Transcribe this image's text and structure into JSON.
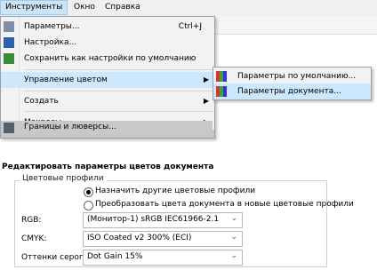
{
  "menubar": {
    "items": [
      {
        "label": "Инструменты",
        "active": true
      },
      {
        "label": "Окно",
        "active": false
      },
      {
        "label": "Справка",
        "active": false
      }
    ]
  },
  "menu": {
    "items": [
      {
        "label": "Параметры...",
        "shortcut": "Ctrl+J",
        "icon": "options-icon"
      },
      {
        "label": "Настройка...",
        "icon": "customize-icon"
      },
      {
        "label": "Сохранить как настройки по умолчанию",
        "icon": "save-defaults-icon"
      },
      {
        "label": "Управление цветом",
        "submenu": true
      },
      {
        "label": "Создать",
        "submenu": true
      },
      {
        "label": "Макросы",
        "submenu": true
      },
      {
        "label": "Границы и люверсы...",
        "icon": "grommets-icon"
      }
    ]
  },
  "submenu": {
    "items": [
      {
        "label": "Параметры по умолчанию...",
        "icon": "palette-icon"
      },
      {
        "label": "Параметры документа...",
        "icon": "palette-icon"
      }
    ]
  },
  "dialog": {
    "title": "Редактировать параметры цветов документа",
    "group_label": "Цветовые профили",
    "radio_assign": "Назначить другие цветовые профили",
    "radio_convert": "Преобразовать цвета документа в новые цветовые профили",
    "rgb_label": "RGB:",
    "rgb_value": "(Монитор-1) sRGB IEC61966-2.1",
    "cmyk_label": "CMYK:",
    "cmyk_value": "ISO Coated v2 300% (ECI)",
    "gray_label": "Оттенки серого:",
    "gray_value": "Dot Gain 15%"
  }
}
